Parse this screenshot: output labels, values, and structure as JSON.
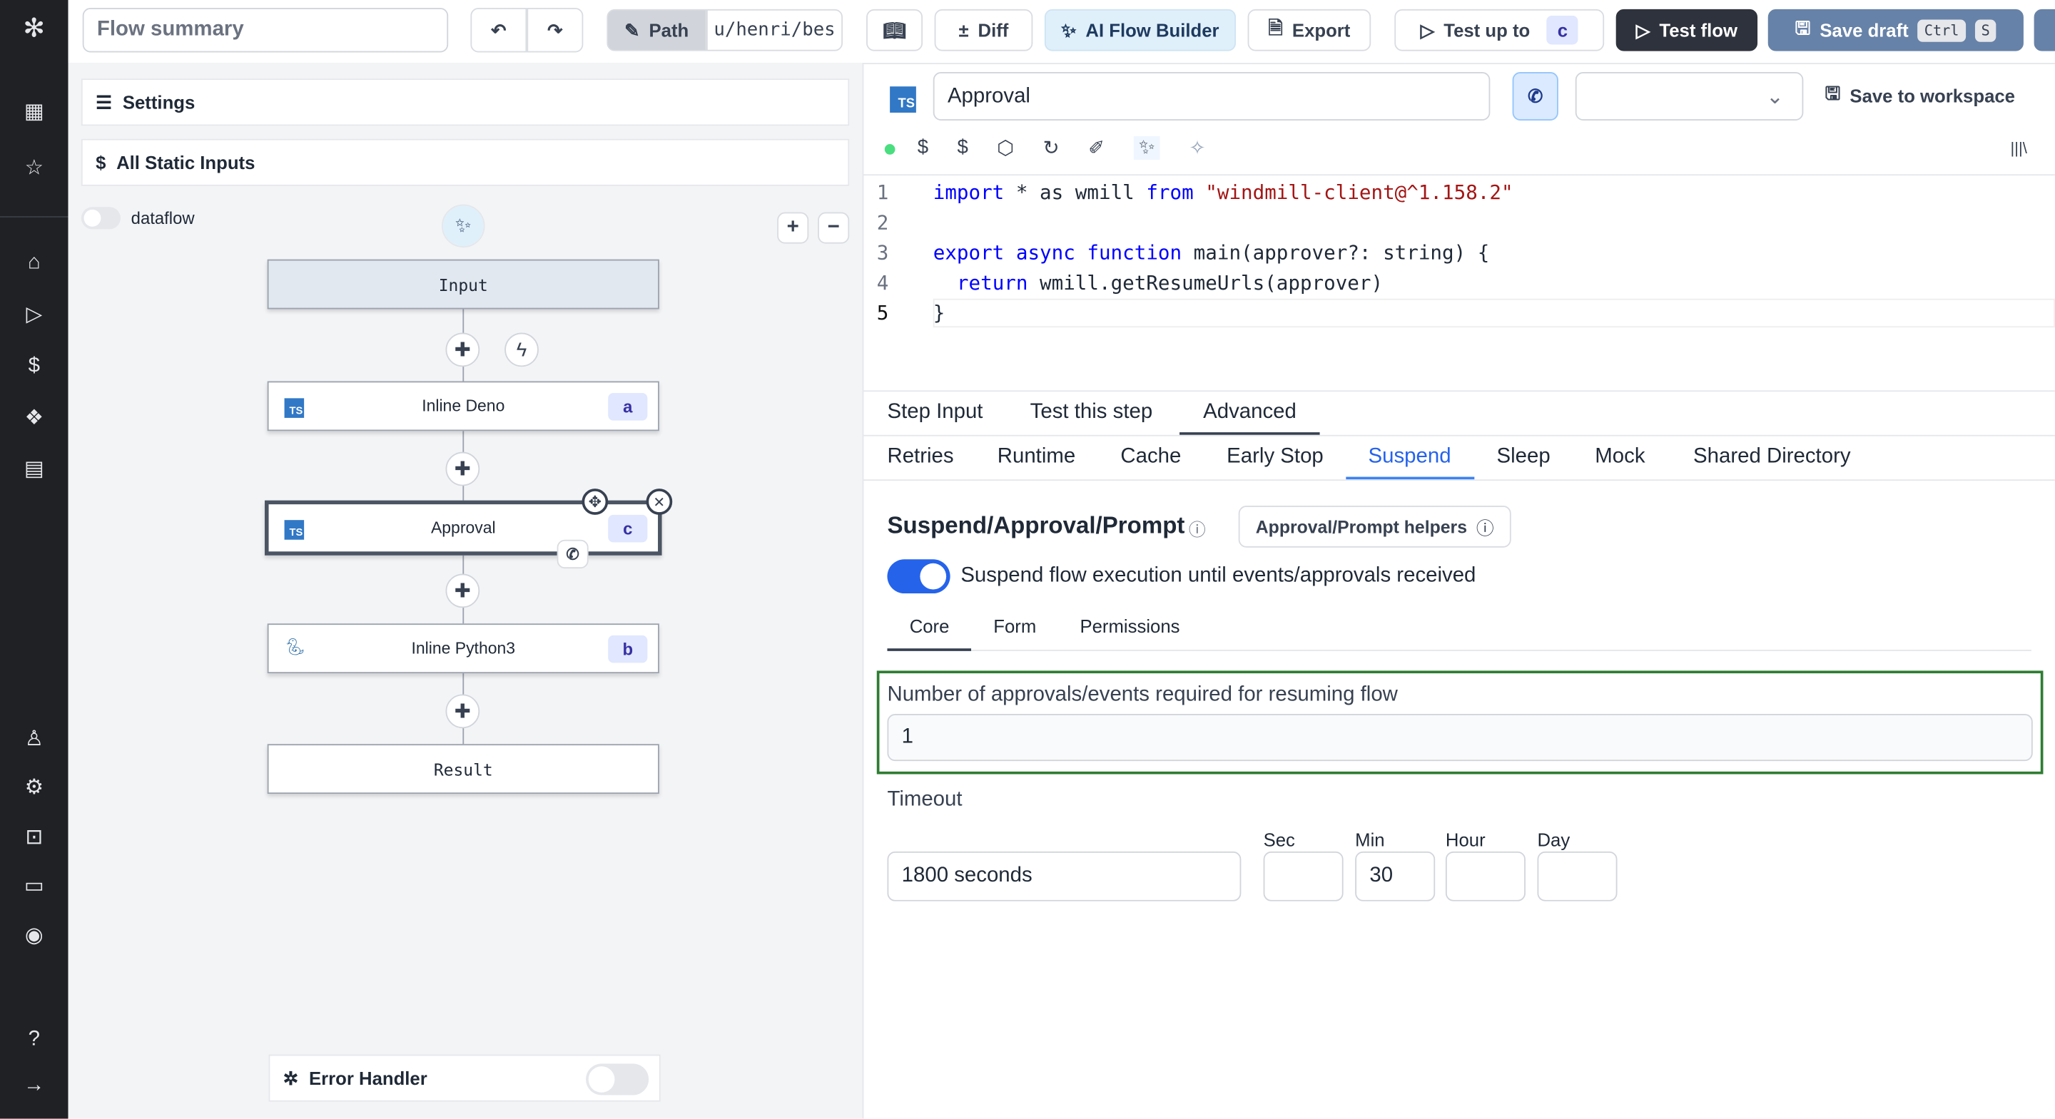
{
  "header": {
    "summary_placeholder": "Flow summary",
    "path_label": "Path",
    "path_value": "u/henri/bes",
    "diff": "Diff",
    "ai_builder": "AI Flow Builder",
    "export": "Export",
    "test_up_to": "Test up to",
    "test_up_to_step": "c",
    "test_flow": "Test flow",
    "save_draft": "Save draft",
    "kbd_ctrl": "Ctrl",
    "kbd_s": "S"
  },
  "left": {
    "settings": "Settings",
    "static_inputs": "All Static Inputs",
    "dataflow": "dataflow",
    "nodes": {
      "input": "Input",
      "deno": "Inline Deno",
      "deno_id": "a",
      "approval": "Approval",
      "approval_id": "c",
      "python": "Inline Python3",
      "python_id": "b",
      "result": "Result"
    },
    "error_handler": "Error Handler"
  },
  "editor": {
    "step_name": "Approval",
    "save_workspace": "Save to workspace",
    "lines": [
      "1",
      "2",
      "3",
      "4",
      "5"
    ]
  },
  "tabs": [
    "Step Input",
    "Test this step",
    "Advanced"
  ],
  "subtabs": [
    "Retries",
    "Runtime",
    "Cache",
    "Early Stop",
    "Suspend",
    "Sleep",
    "Mock",
    "Shared Directory"
  ],
  "suspend": {
    "title": "Suspend/Approval/Prompt",
    "helpers": "Approval/Prompt helpers",
    "toggle_label": "Suspend flow execution until events/approvals received",
    "toggle_on": true,
    "inner_tabs": [
      "Core",
      "Form",
      "Permissions"
    ],
    "required_label": "Number of approvals/events required for resuming flow",
    "required_value": "1",
    "timeout_label": "Timeout",
    "timeout_value": "1800 seconds",
    "sec": "Sec",
    "min": "Min",
    "hour": "Hour",
    "day": "Day",
    "min_value": "30"
  },
  "colors": {
    "sidebar": "#1f2125",
    "accent": "#3b82f6",
    "test_flow_bg": "#2e323c",
    "save_draft_bg": "#6782a8",
    "required_border": "#2e7d32"
  }
}
